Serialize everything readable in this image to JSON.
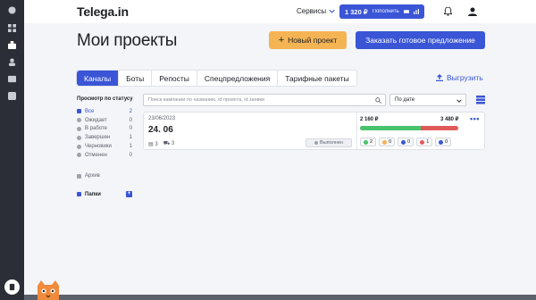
{
  "header": {
    "logo": "Telega.in",
    "services_label": "Сервисы",
    "balance": "1 320 ₽",
    "topup_label": "Пополнить"
  },
  "page": {
    "title": "Мои проекты",
    "new_project_label": "Новый проект",
    "order_label": "Заказать готовое предложение"
  },
  "tabs": [
    {
      "label": "Каналы",
      "active": true
    },
    {
      "label": "Боты",
      "active": false
    },
    {
      "label": "Репосты",
      "active": false
    },
    {
      "label": "Спецпредложения",
      "active": false
    },
    {
      "label": "Тарифные пакеты",
      "active": false
    }
  ],
  "export_label": "Выгрузить",
  "filters": {
    "title": "Просмотр по статусу",
    "items": [
      {
        "label": "Все",
        "count": "2",
        "active": true
      },
      {
        "label": "Ожидает",
        "count": "0",
        "active": false
      },
      {
        "label": "В работе",
        "count": "0",
        "active": false
      },
      {
        "label": "Завершен",
        "count": "1",
        "active": false
      },
      {
        "label": "Черновики",
        "count": "1",
        "active": false
      },
      {
        "label": "Отменен",
        "count": "0",
        "active": false
      }
    ],
    "archive_label": "Архив",
    "folders_label": "Папки"
  },
  "search": {
    "placeholder": "Поиск кампании по названию, id проекта, id заявки"
  },
  "sort": {
    "value": "По дате"
  },
  "campaign": {
    "date": "23/06/2023",
    "name": "24. 06",
    "channels": "3",
    "posts": "3",
    "status": "Выполнен",
    "spent": "2 160 ₽",
    "total": "3 480 ₽",
    "progress": 0.62,
    "chips": [
      {
        "value": "2",
        "color": "#47c36b"
      },
      {
        "value": "0",
        "color": "#f5b454"
      },
      {
        "value": "0",
        "color": "#3a55d6"
      },
      {
        "value": "1",
        "color": "#e05a5a"
      },
      {
        "value": "0",
        "color": "#3a55d6"
      }
    ]
  }
}
